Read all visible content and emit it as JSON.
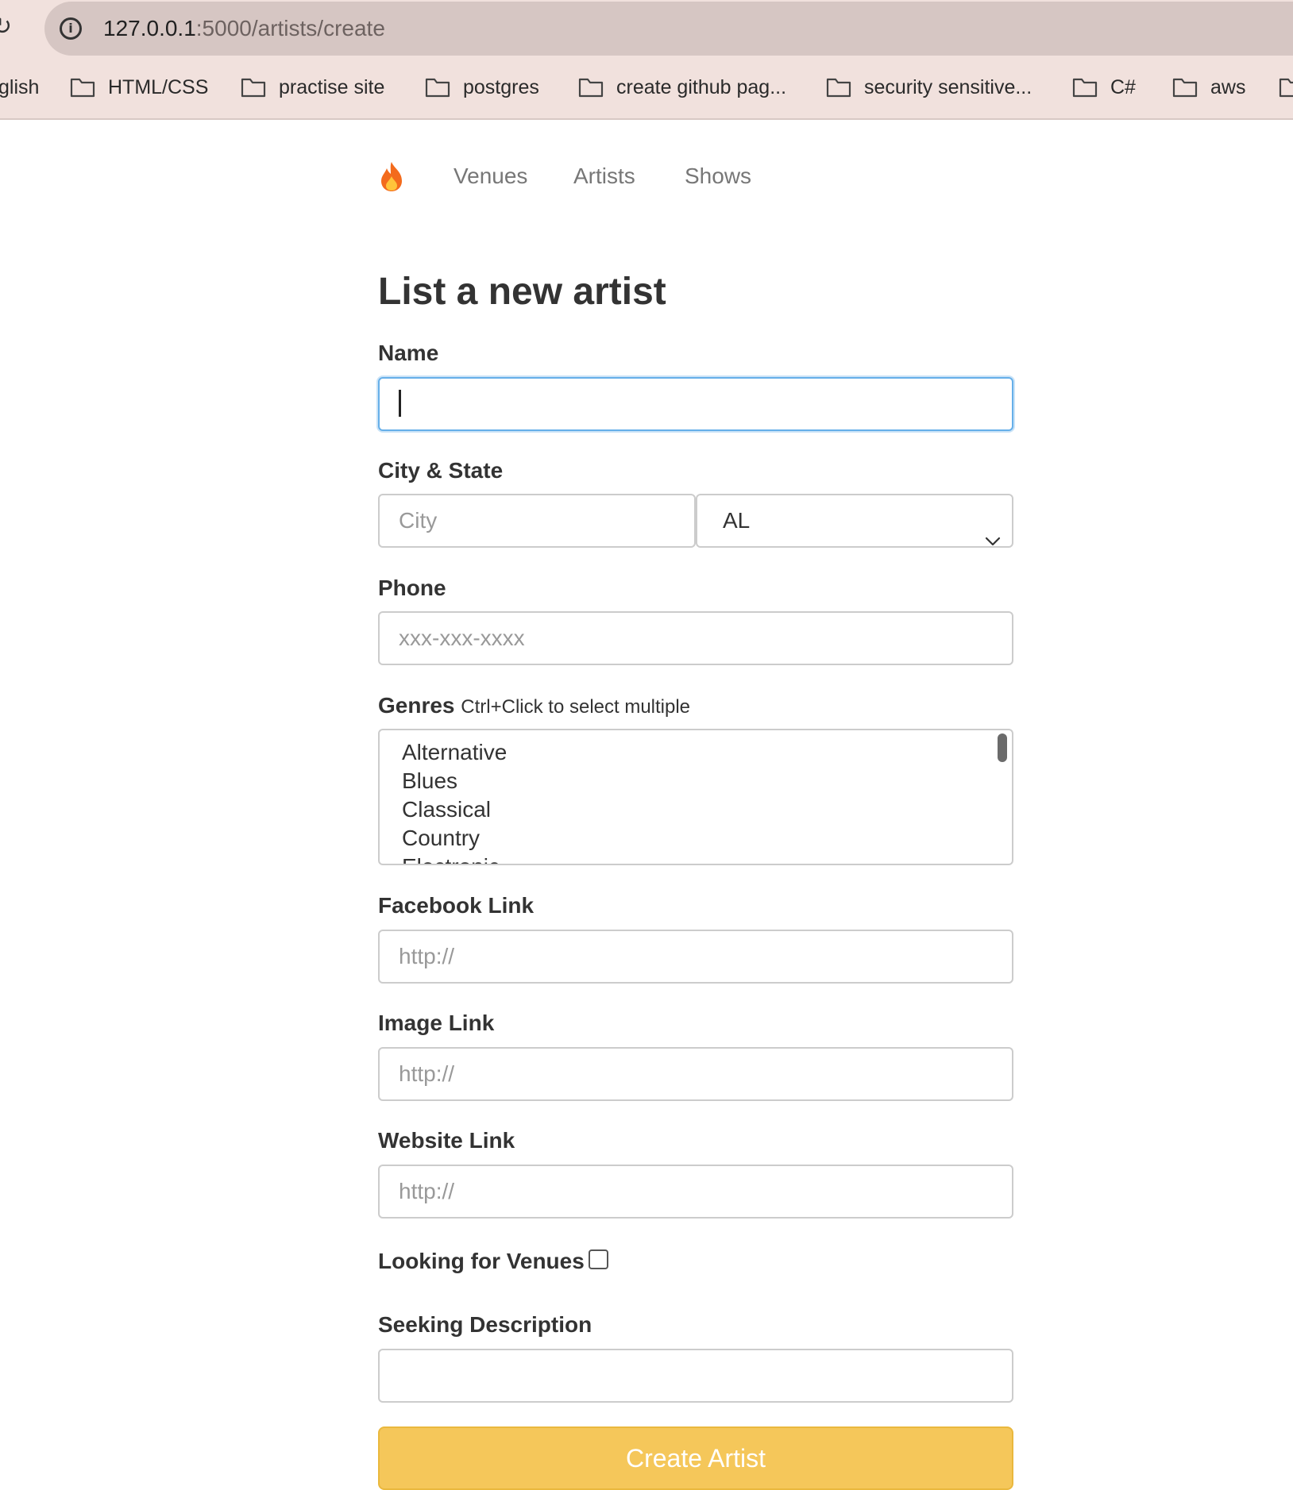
{
  "browser": {
    "url_host": "127.0.0.1",
    "url_path": ":5000/artists/create",
    "bookmarks": [
      "glish",
      "HTML/CSS",
      "practise site",
      "postgres",
      "create github pag...",
      "security sensitive...",
      "C#",
      "aws"
    ]
  },
  "nav": {
    "brand_icon": "flame-icon",
    "links": [
      "Venues",
      "Artists",
      "Shows"
    ]
  },
  "form": {
    "title": "List a new artist",
    "name_label": "Name",
    "name_value": "",
    "city_state_label": "City & State",
    "city_placeholder": "City",
    "state_value": "AL",
    "phone_label": "Phone",
    "phone_placeholder": "xxx-xxx-xxxx",
    "genres_label": "Genres",
    "genres_hint": "Ctrl+Click to select multiple",
    "genres_options": [
      "Alternative",
      "Blues",
      "Classical",
      "Country",
      "Electronic"
    ],
    "facebook_label": "Facebook Link",
    "facebook_placeholder": "http://",
    "image_label": "Image Link",
    "image_placeholder": "http://",
    "website_label": "Website Link",
    "website_placeholder": "http://",
    "looking_label": "Looking for Venues",
    "looking_checked": false,
    "seeking_label": "Seeking Description",
    "seeking_value": "",
    "submit_label": "Create Artist"
  },
  "colors": {
    "accent_button": "#f5c75a",
    "focus_border": "#66afe9",
    "chrome_bg": "#f1e1dd"
  }
}
